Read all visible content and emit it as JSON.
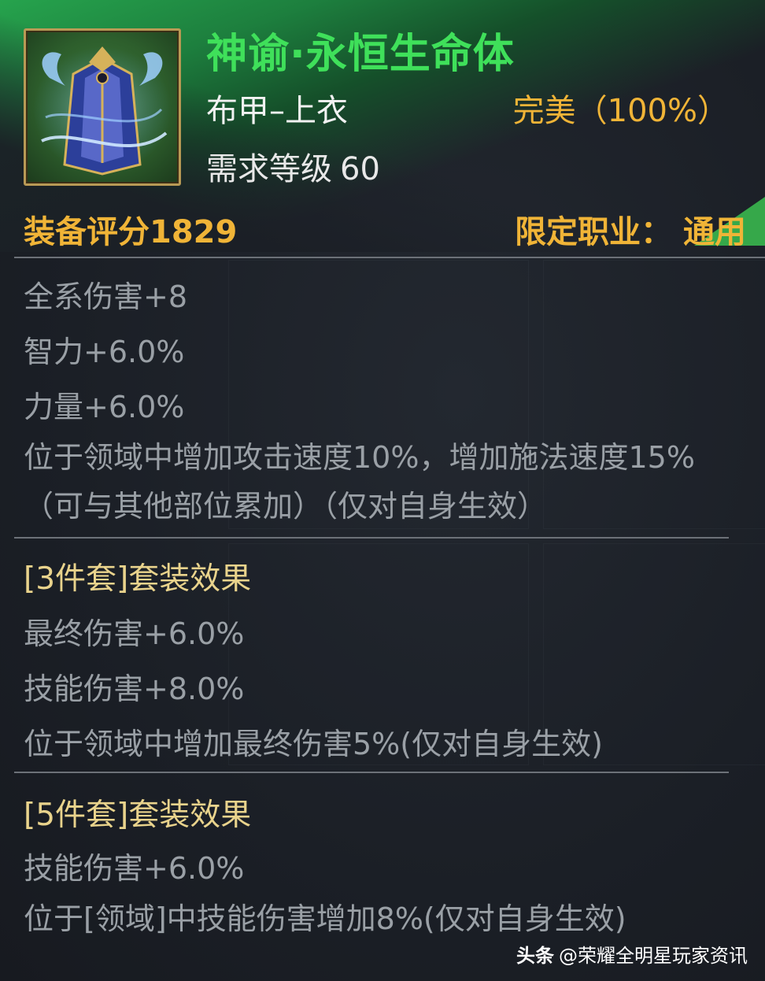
{
  "item": {
    "name": "神谕·永恒生命体",
    "type": "布甲–上衣",
    "quality": "完美（100%）",
    "level_label": "需求等级",
    "level_value": "60",
    "score": "装备评分1829",
    "job": "限定职业： 通用",
    "icon": "robe-armor-icon"
  },
  "stats": [
    "全系伤害+8",
    "智力+6.0%",
    "力量+6.0%",
    "位于领域中增加攻击速度10%，增加施法速度15%（可与其他部位累加）（仅对自身生效）"
  ],
  "set3": {
    "title": "[3件套]套装效果",
    "effects": [
      "最终伤害+6.0%",
      "技能伤害+8.0%",
      "位于领域中增加最终伤害5%(仅对自身生效)"
    ]
  },
  "set5": {
    "title": "[5件套]套装效果",
    "effects": [
      "技能伤害+6.0%",
      "位于[领域]中技能伤害增加8%(仅对自身生效)"
    ]
  },
  "watermark": {
    "brand": "头条",
    "account": "@荣耀全明星玩家资讯"
  },
  "colors": {
    "title_green": "#3fe05a",
    "gold": "#f0b437",
    "stat_gray": "#9aa0a6",
    "set_title": "#e9d38c"
  }
}
